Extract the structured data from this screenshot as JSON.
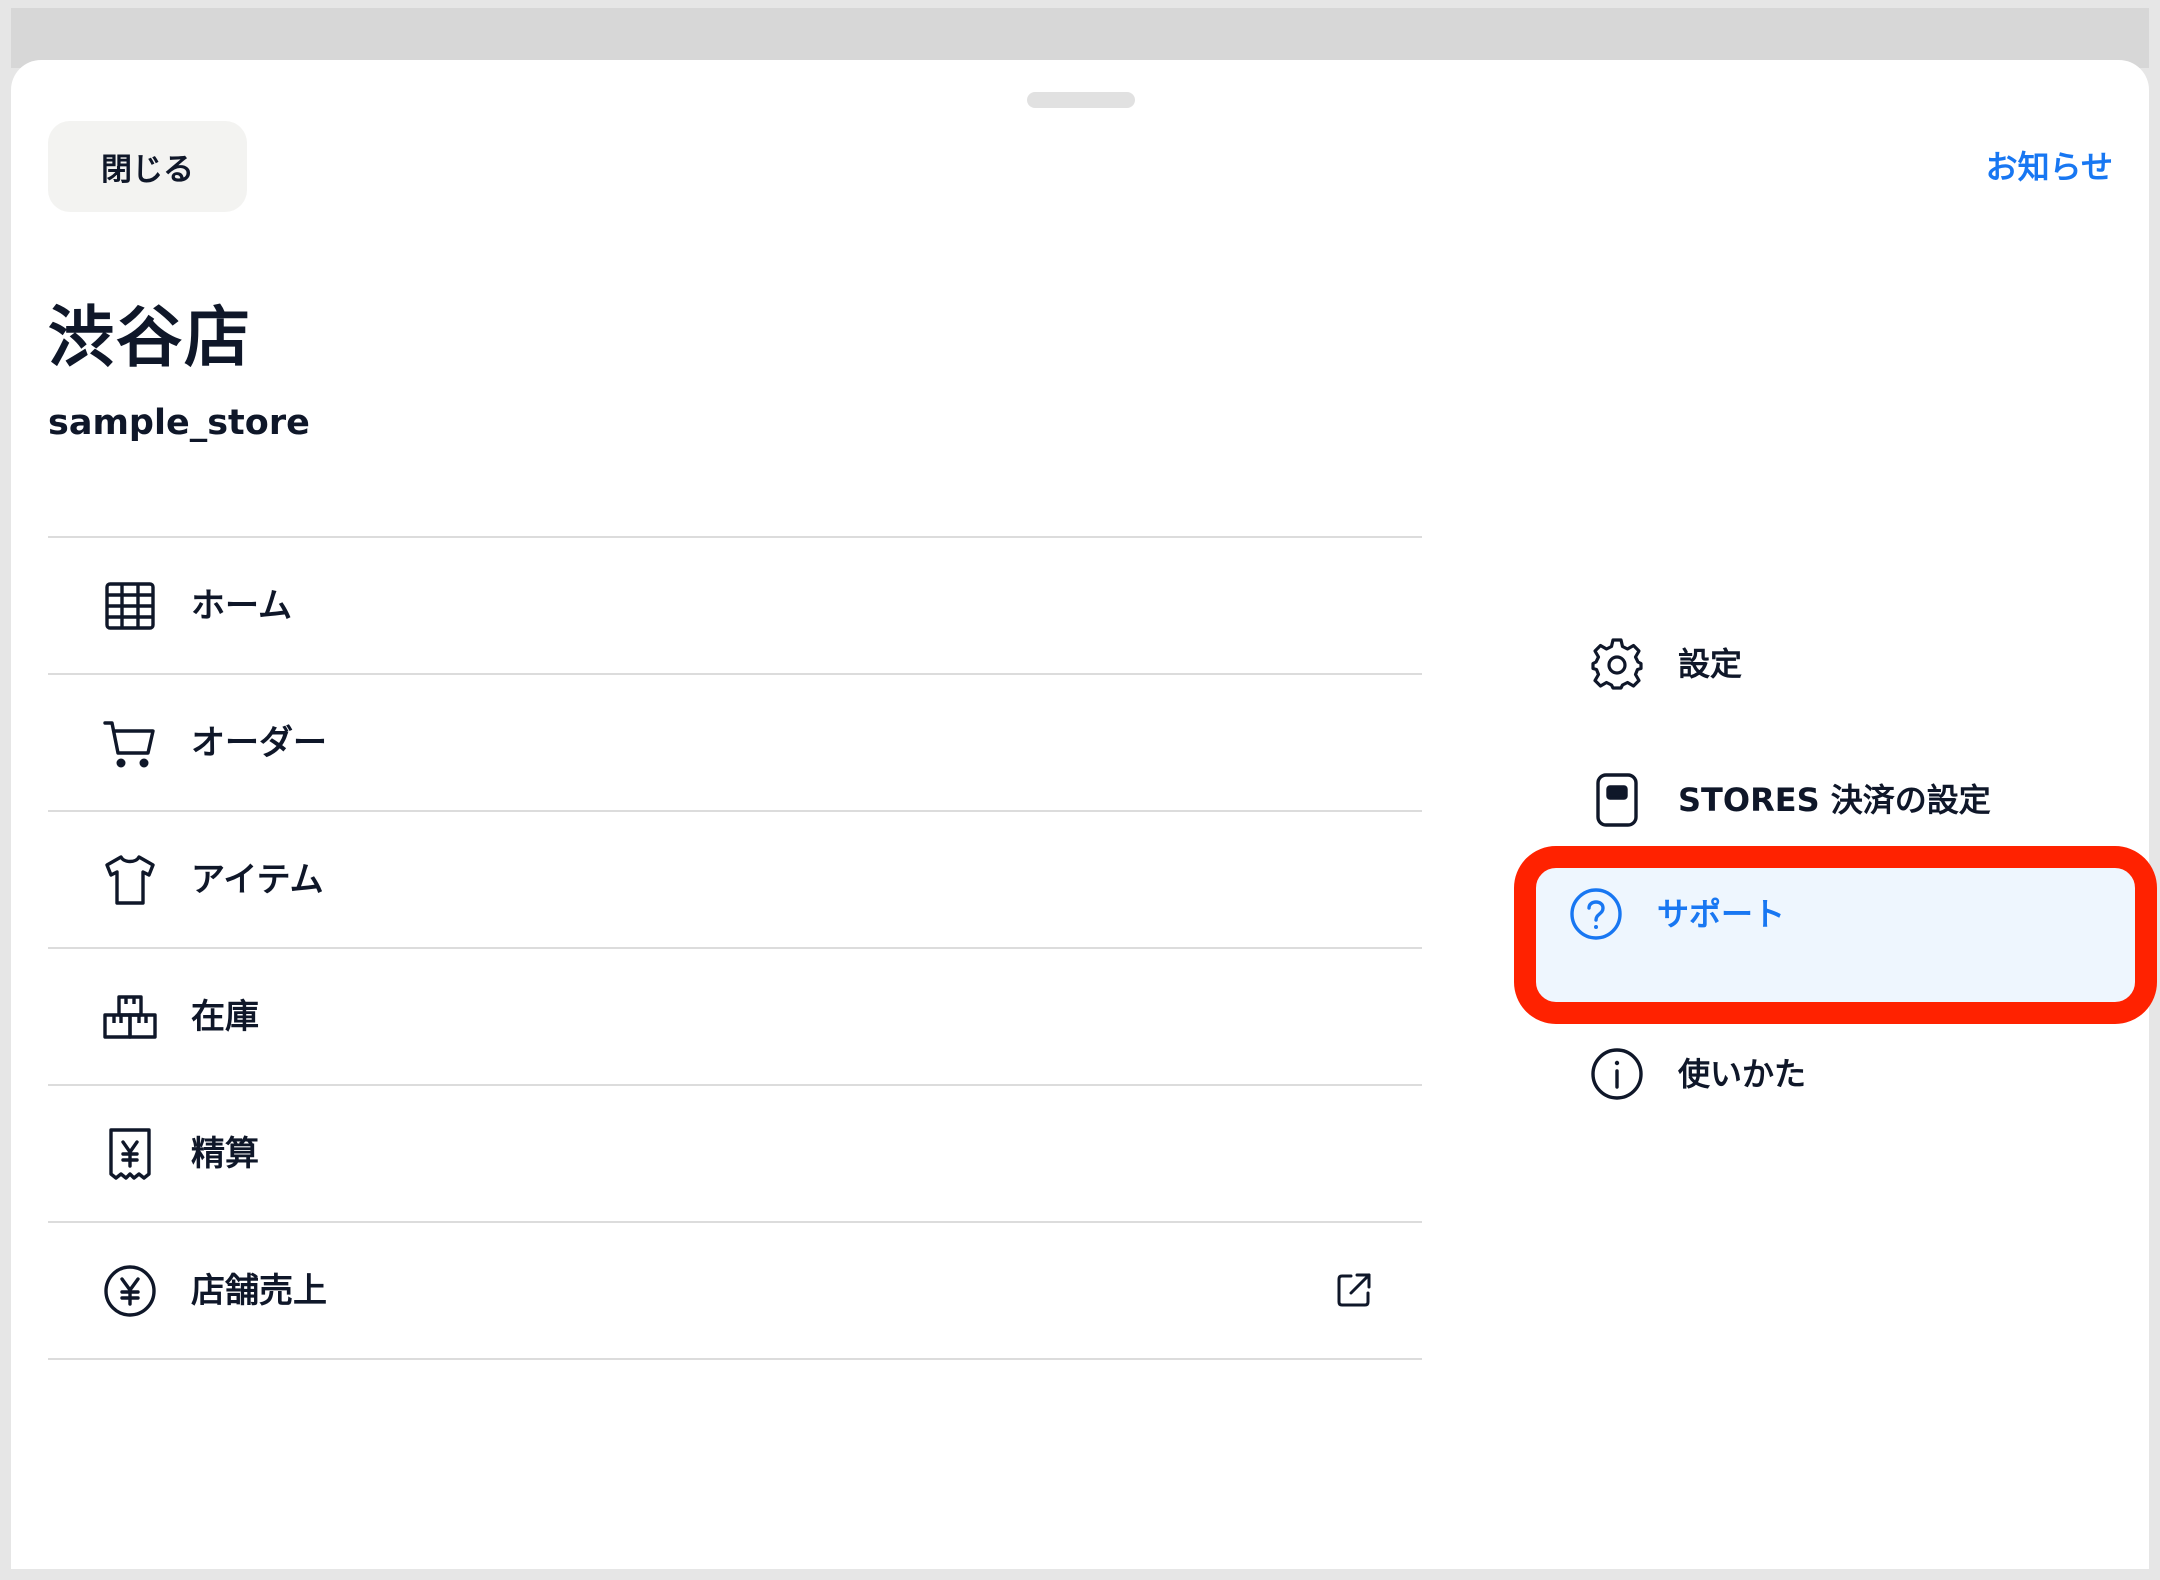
{
  "header": {
    "close_label": "閉じる",
    "notice_label": "お知らせ"
  },
  "store": {
    "name": "渋谷店",
    "id": "sample_store"
  },
  "menu": {
    "items": [
      {
        "label": "ホーム",
        "icon": "home-grid-icon"
      },
      {
        "label": "オーダー",
        "icon": "cart-icon"
      },
      {
        "label": "アイテム",
        "icon": "tshirt-icon"
      },
      {
        "label": "在庫",
        "icon": "boxes-icon"
      },
      {
        "label": "精算",
        "icon": "receipt-yen-icon"
      },
      {
        "label": "店舗売上",
        "icon": "yen-circle-icon",
        "trailing_icon": "external-link-icon"
      }
    ]
  },
  "side": {
    "items": [
      {
        "label": "設定",
        "icon": "gear-icon"
      },
      {
        "label": "STORES 決済の設定",
        "icon": "card-reader-icon"
      },
      {
        "label": "サポート",
        "icon": "question-circle-icon",
        "active": true
      },
      {
        "label": "使いかた",
        "icon": "info-circle-icon"
      }
    ]
  },
  "colors": {
    "accent": "#1877f2",
    "text": "#0f1729",
    "highlight_border": "#ff2200",
    "active_background": "#eef6fe"
  }
}
